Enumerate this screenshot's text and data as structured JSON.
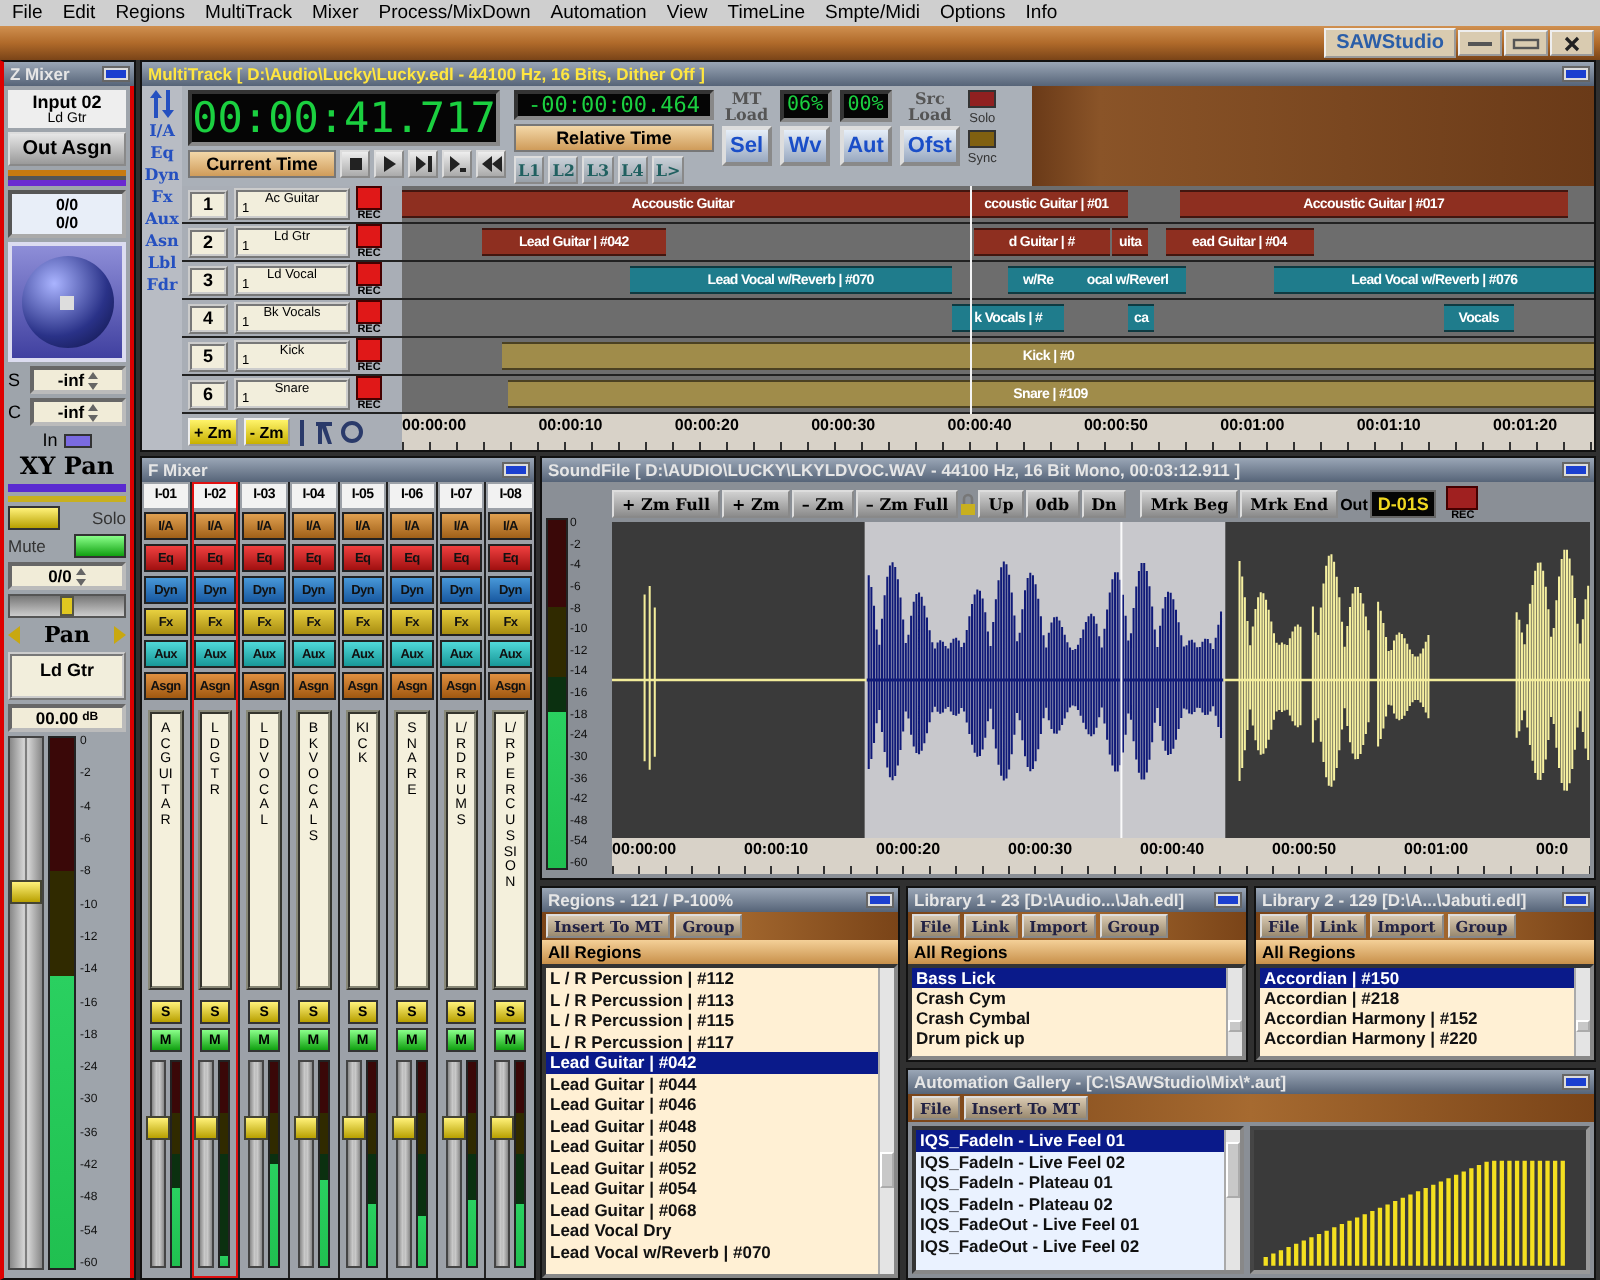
{
  "menu": [
    "File",
    "Edit",
    "Regions",
    "MultiTrack",
    "Mixer",
    "Process/MixDown",
    "Automation",
    "View",
    "TimeLine",
    "Smpte/Midi",
    "Options",
    "Info"
  ],
  "app_logo": "SAWStudio",
  "z_mixer": {
    "title": "Z Mixer",
    "input": "Input 02",
    "input_name": "Ld Gtr",
    "out_assign": "Out Asgn",
    "pan_readout": [
      "0/0",
      "0/0"
    ],
    "sends": [
      {
        "label": "S",
        "value": "-inf"
      },
      {
        "label": "C",
        "value": "-inf"
      }
    ],
    "input_toggle": {
      "label": "In",
      "on": true
    },
    "xy_pan": "XY Pan",
    "solo": "Solo",
    "mute": "Mute",
    "pan_value": "0/0",
    "pan": {
      "level": 0.5
    },
    "pan_label": "Pan",
    "track_name": "Ld Gtr",
    "gain": "00.00",
    "gain_unit": "dB",
    "fader": {
      "level": 0.72
    },
    "meter": {
      "level": 0.55
    },
    "meter_scale": [
      "0",
      "-2",
      "-4",
      "-6",
      "-8",
      "-10",
      "-12",
      "-14",
      "-16",
      "-18",
      "-24",
      "-30",
      "-36",
      "-42",
      "-48",
      "-54",
      "-60"
    ]
  },
  "multitrack": {
    "title": "MultiTrack  [ D:\\Audio\\Lucky\\Lucky.edl - 44100 Hz, 16 Bits, Dither Off ]",
    "side_labels": [
      "I/A",
      "Eq",
      "Dyn",
      "Fx",
      "Aux",
      "Asn",
      "Lbl",
      "Fdr"
    ],
    "current_time": "00:00:41.717",
    "current_time_label": "Current Time",
    "relative_time": "-00:00:00.464",
    "relative_time_label": "Relative Time",
    "locators": [
      "L1",
      "L2",
      "L3",
      "L4",
      "L>"
    ],
    "mt_load": "MT Load",
    "readouts": [
      "06%",
      "00%"
    ],
    "src_load": "Src Load",
    "mode_buttons": [
      "Sel",
      "Wv",
      "Aut",
      "Ofst"
    ],
    "solo": "Solo",
    "sync": "Sync",
    "tracks": [
      {
        "number": "1",
        "name": "Ac Guitar",
        "sub": "1",
        "rec": "REC",
        "color": "#8e2f20",
        "regions": [
          "Accoustic Guitar",
          "ccoustic Guitar | #01",
          "Accoustic Guitar | #017"
        ]
      },
      {
        "number": "2",
        "name": "Ld Gtr",
        "sub": "1",
        "rec": "REC",
        "color": "#8e2f20",
        "regions": [
          "Lead Guitar | #042",
          "d Guitar | #",
          "uita",
          "ead Guitar | #04"
        ]
      },
      {
        "number": "3",
        "name": "Ld Vocal",
        "sub": "1",
        "rec": "REC",
        "color": "#1f7c8c",
        "regions": [
          "Lead Vocal w/Reverb | #070",
          "w/Re",
          "ocal w/Reverl",
          "Lead Vocal w/Reverb | #076"
        ]
      },
      {
        "number": "4",
        "name": "Bk Vocals",
        "sub": "1",
        "rec": "REC",
        "color": "#1f7c8c",
        "regions": [
          "k Vocals | #",
          "ca",
          "Vocals"
        ]
      },
      {
        "number": "5",
        "name": "Kick",
        "sub": "1",
        "rec": "REC",
        "color": "#a08c4a",
        "regions": [
          "Kick | #0"
        ]
      },
      {
        "number": "6",
        "name": "Snare",
        "sub": "1",
        "rec": "REC",
        "color": "#a08c4a",
        "regions": [
          "Snare | #109"
        ]
      }
    ],
    "zoom_buttons": [
      "+ Zm",
      "- Zm"
    ],
    "ruler": [
      "00:00:00",
      "00:00:10",
      "00:00:20",
      "00:00:30",
      "00:00:40",
      "00:00:50",
      "00:01:00",
      "00:01:10",
      "00:01:20"
    ]
  },
  "f_mixer": {
    "title": "F Mixer",
    "channels": [
      {
        "id": "I-01",
        "label": "AC GUITAR",
        "selected": false,
        "buttons": [
          "I/A",
          "Eq",
          "Dyn",
          "Fx",
          "Aux",
          "Asgn"
        ],
        "solo": "S",
        "mute": "M",
        "fader": {
          "level": 0.7
        },
        "meter": {
          "level": 0.38
        }
      },
      {
        "id": "I-02",
        "label": "LD GTR",
        "selected": true,
        "buttons": [
          "I/A",
          "Eq",
          "Dyn",
          "Fx",
          "Aux",
          "Asgn"
        ],
        "solo": "S",
        "mute": "M",
        "fader": {
          "level": 0.7
        },
        "meter": {
          "level": 0.05
        }
      },
      {
        "id": "I-03",
        "label": "LD VOCAL",
        "selected": false,
        "buttons": [
          "I/A",
          "Eq",
          "Dyn",
          "Fx",
          "Aux",
          "Asgn"
        ],
        "solo": "S",
        "mute": "M",
        "fader": {
          "level": 0.7
        },
        "meter": {
          "level": 0.5
        }
      },
      {
        "id": "I-04",
        "label": "BK VOCALS",
        "selected": false,
        "buttons": [
          "I/A",
          "Eq",
          "Dyn",
          "Fx",
          "Aux",
          "Asgn"
        ],
        "solo": "S",
        "mute": "M",
        "fader": {
          "level": 0.7
        },
        "meter": {
          "level": 0.42
        }
      },
      {
        "id": "I-05",
        "label": "KICK",
        "selected": false,
        "buttons": [
          "I/A",
          "Eq",
          "Dyn",
          "Fx",
          "Aux",
          "Asgn"
        ],
        "solo": "S",
        "mute": "M",
        "fader": {
          "level": 0.7
        },
        "meter": {
          "level": 0.3
        }
      },
      {
        "id": "I-06",
        "label": "SNARE",
        "selected": false,
        "buttons": [
          "I/A",
          "Eq",
          "Dyn",
          "Fx",
          "Aux",
          "Asgn"
        ],
        "solo": "S",
        "mute": "M",
        "fader": {
          "level": 0.7
        },
        "meter": {
          "level": 0.25
        }
      },
      {
        "id": "I-07",
        "label": "L/R DRUMS",
        "selected": false,
        "buttons": [
          "I/A",
          "Eq",
          "Dyn",
          "Fx",
          "Aux",
          "Asgn"
        ],
        "solo": "S",
        "mute": "M",
        "fader": {
          "level": 0.7
        },
        "meter": {
          "level": 0.32
        }
      },
      {
        "id": "I-08",
        "label": "L/R PERCUSSION",
        "selected": false,
        "buttons": [
          "I/A",
          "Eq",
          "Dyn",
          "Fx",
          "Aux",
          "Asgn"
        ],
        "solo": "S",
        "mute": "M",
        "fader": {
          "level": 0.7
        },
        "meter": {
          "level": 0.3
        }
      }
    ]
  },
  "soundfile": {
    "title": "SoundFile  [ D:\\AUDIO\\LUCKY\\LKYLDVOC.WAV - 44100 Hz, 16 Bit Mono, 00:03:12.911 ]",
    "zoom_buttons": [
      "+ Zm Full",
      "+ Zm",
      "– Zm",
      "– Zm Full"
    ],
    "level_buttons": [
      "Up",
      "0db",
      "Dn"
    ],
    "marker_buttons": [
      "Mrk Beg",
      "Mrk End"
    ],
    "out_label": "Out",
    "out_device": "D-01S",
    "rec": "REC",
    "meter": {
      "level": 0.45
    },
    "meter_scale": [
      "0",
      "-2",
      "-4",
      "-6",
      "-8",
      "-10",
      "-12",
      "-14",
      "-16",
      "-18",
      "-24",
      "-30",
      "-36",
      "-42",
      "-48",
      "-54",
      "-60"
    ],
    "ruler": [
      "00:00:00",
      "00:00:10",
      "00:00:20",
      "00:00:30",
      "00:00:40",
      "00:00:50",
      "00:01:00",
      "00:0"
    ]
  },
  "regions": {
    "title": "Regions - 121 / P-100%",
    "buttons": [
      "Insert To MT",
      "Group"
    ],
    "header": "All Regions",
    "items": [
      {
        "label": "L / R Percussion | #112",
        "selected": false
      },
      {
        "label": "L / R Percussion | #113",
        "selected": false
      },
      {
        "label": "L / R Percussion | #115",
        "selected": false
      },
      {
        "label": "L / R Percussion | #117",
        "selected": false
      },
      {
        "label": "Lead Guitar | #042",
        "selected": true
      },
      {
        "label": "Lead Guitar | #044",
        "selected": false
      },
      {
        "label": "Lead Guitar | #046",
        "selected": false
      },
      {
        "label": "Lead Guitar | #048",
        "selected": false
      },
      {
        "label": "Lead Guitar | #050",
        "selected": false
      },
      {
        "label": "Lead Guitar | #052",
        "selected": false
      },
      {
        "label": "Lead Guitar | #054",
        "selected": false
      },
      {
        "label": "Lead Guitar | #068",
        "selected": false
      },
      {
        "label": "Lead Vocal Dry",
        "selected": false
      },
      {
        "label": "Lead Vocal w/Reverb | #070",
        "selected": false
      }
    ]
  },
  "libraries": [
    {
      "title": "Library 1 - 23 [D:\\Audio...\\Jah.edl]",
      "buttons": [
        "File",
        "Link",
        "Import",
        "Group"
      ],
      "header": "All Regions",
      "items": [
        {
          "label": "Bass Lick",
          "selected": true
        },
        {
          "label": "Crash Cym",
          "selected": false
        },
        {
          "label": "Crash Cymbal",
          "selected": false
        },
        {
          "label": "Drum pick up",
          "selected": false
        }
      ]
    },
    {
      "title": "Library 2 - 129 [D:\\A...\\Jabuti.edl]",
      "buttons": [
        "File",
        "Link",
        "Import",
        "Group"
      ],
      "header": "All Regions",
      "items": [
        {
          "label": "Accordian | #150",
          "selected": true
        },
        {
          "label": "Accordian | #218",
          "selected": false
        },
        {
          "label": "Accordian Harmony | #152",
          "selected": false
        },
        {
          "label": "Accordian Harmony | #220",
          "selected": false
        }
      ]
    }
  ],
  "automation": {
    "title": "Automation Gallery  - [C:\\SAWStudio\\Mix\\*.aut]",
    "buttons": [
      "File",
      "Insert To MT"
    ],
    "items": [
      {
        "label": "IQS_FadeIn - Live Feel 01",
        "selected": true
      },
      {
        "label": "IQS_FadeIn - Live Feel 02",
        "selected": false
      },
      {
        "label": "IQS_FadeIn - Plateau 01",
        "selected": false
      },
      {
        "label": "IQS_FadeIn - Plateau 02",
        "selected": false
      },
      {
        "label": "IQS_FadeOut - Live Feel 01",
        "selected": false
      },
      {
        "label": "IQS_FadeOut - Live Feel 02",
        "selected": false
      }
    ]
  }
}
